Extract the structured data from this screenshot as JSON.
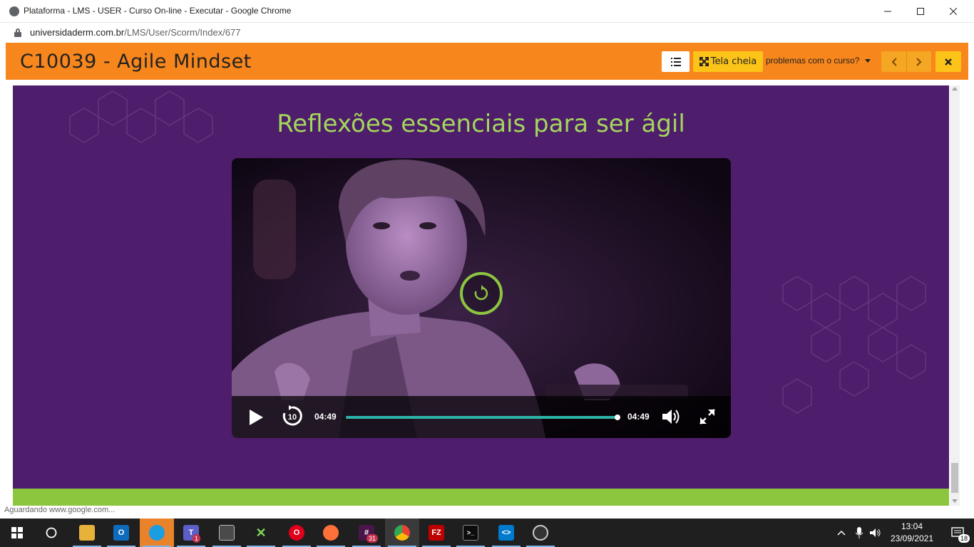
{
  "browser": {
    "window_title": "Plataforma - LMS - USER - Curso On-line - Executar - Google Chrome",
    "url_host": "universidaderm.com.br",
    "url_path": "/LMS/User/Scorm/Index/677",
    "status_text": "Aguardando www.google.com..."
  },
  "lms_header": {
    "course_title": "C10039 - Agile Mindset",
    "fullscreen_label": "Tela cheia",
    "problems_label": "problemas com o curso?",
    "accent_color": "#f7861c"
  },
  "slide": {
    "heading": "Reflexões essenciais para ser ágil",
    "background_color": "#4e1d6b",
    "band_color": "#8cc63f"
  },
  "video": {
    "current_time": "04:49",
    "duration": "04:49",
    "progress_fraction": 1.0,
    "rewind_seconds": "10",
    "overlay_icon": "replay-icon"
  },
  "taskbar": {
    "apps": [
      {
        "name": "start-button"
      },
      {
        "name": "search-button"
      },
      {
        "name": "file-explorer"
      },
      {
        "name": "outlook"
      },
      {
        "name": "edge"
      },
      {
        "name": "teams",
        "badge": "1"
      },
      {
        "name": "network-app"
      },
      {
        "name": "excel-like-app"
      },
      {
        "name": "opera"
      },
      {
        "name": "firefox"
      },
      {
        "name": "slack",
        "badge": "31"
      },
      {
        "name": "chrome"
      },
      {
        "name": "filezilla"
      },
      {
        "name": "terminal"
      },
      {
        "name": "vscode"
      },
      {
        "name": "aperture-app"
      }
    ],
    "time": "13:04",
    "date": "23/09/2021",
    "notification_count": "18"
  }
}
